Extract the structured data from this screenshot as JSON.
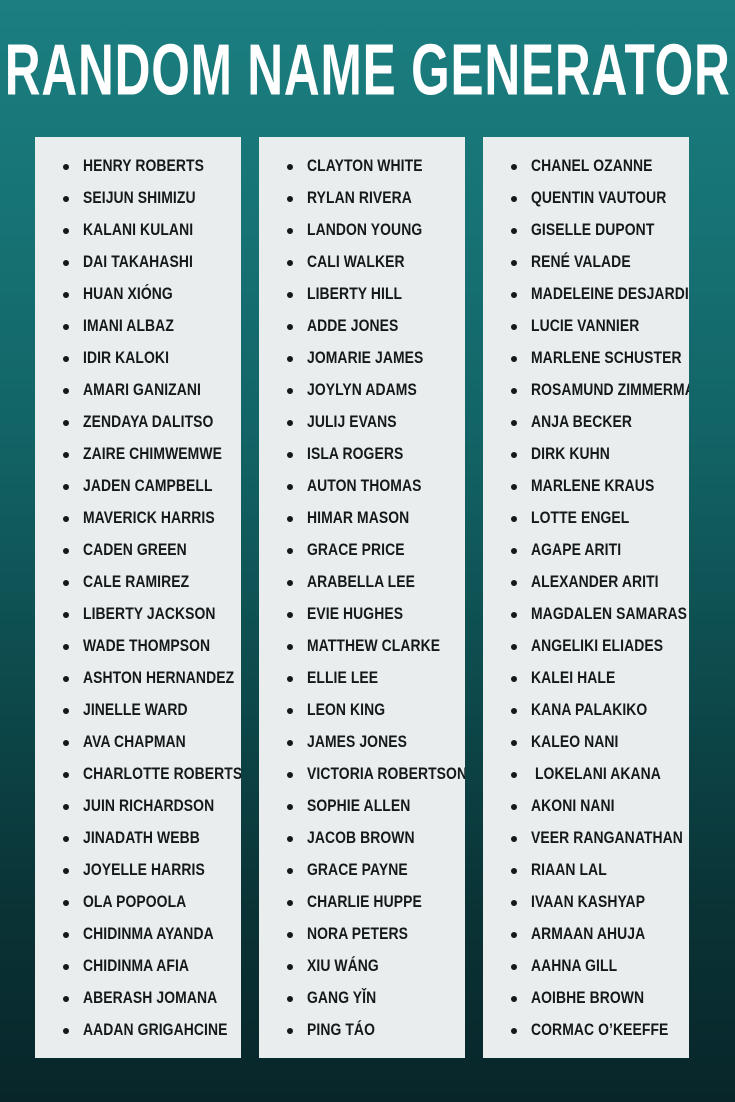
{
  "header": {
    "title": "RANDOM NAME GENERATOR"
  },
  "theme": {
    "background_top": "#1b7e80",
    "background_bottom": "#08262a",
    "card_background": "#e9edee",
    "title_color": "#ffffff",
    "text_color": "#14191a",
    "bullet_color": "#14191a"
  },
  "columns": [
    {
      "id": "column-1",
      "names": [
        "HENRY ROBERTS",
        "SEIJUN SHIMIZU",
        "KALANI KULANI",
        "DAI TAKAHASHI",
        "HUAN XIÓNG",
        "IMANI ALBAZ",
        "IDIR KALOKI",
        "AMARI GANIZANI",
        "ZENDAYA DALITSO",
        "ZAIRE CHIMWEMWE",
        "JADEN CAMPBELL",
        "MAVERICK HARRIS",
        "CADEN GREEN",
        "CALE RAMIREZ",
        "LIBERTY JACKSON",
        "WADE THOMPSON",
        "ASHTON HERNANDEZ",
        "JINELLE WARD",
        "AVA CHAPMAN",
        "CHARLOTTE ROBERTSON",
        "JUIN RICHARDSON",
        "JINADATH WEBB",
        "JOYELLE HARRIS",
        "OLA POPOOLA",
        "CHIDINMA AYANDA",
        "CHIDINMA AFIA",
        "ABERASH JOMANA",
        "AADAN GRIGAHCINE"
      ]
    },
    {
      "id": "column-2",
      "names": [
        "CLAYTON WHITE",
        "RYLAN RIVERA",
        "LANDON YOUNG",
        "CALI WALKER",
        "LIBERTY HILL",
        "ADDE JONES",
        "JOMARIE JAMES",
        "JOYLYN ADAMS",
        "JULIJ EVANS",
        "ISLA ROGERS",
        "AUTON THOMAS",
        "HIMAR MASON",
        "GRACE PRICE",
        "ARABELLA LEE",
        "EVIE HUGHES",
        "MATTHEW CLARKE",
        "ELLIE LEE",
        "LEON KING",
        "JAMES JONES",
        "VICTORIA ROBERTSON",
        "SOPHIE ALLEN",
        "JACOB BROWN",
        "GRACE PAYNE",
        "CHARLIE HUPPE",
        "NORA PETERS",
        "XIU WÁNG",
        "GANG YǏN",
        "PING TÁO"
      ]
    },
    {
      "id": "column-3",
      "names": [
        "CHANEL OZANNE",
        "QUENTIN VAUTOUR",
        "GISELLE DUPONT",
        "RENÉ VALADE",
        "MADELEINE DESJARDINS",
        "LUCIE VANNIER",
        "MARLENE SCHUSTER",
        "ROSAMUND ZIMMERMANN",
        "ANJA BECKER",
        "DIRK KUHN",
        "MARLENE KRAUS",
        "LOTTE ENGEL",
        "AGAPE ARITI",
        "ALEXANDER ARITI",
        "MAGDALEN SAMARAS",
        "ANGELIKI ELIADES",
        "KALEI HALE",
        "KANA PALAKIKO",
        "KALEO NANI",
        " LOKELANI AKANA",
        "AKONI NANI",
        "VEER RANGANATHAN",
        "RIAAN LAL",
        "IVAAN KASHYAP",
        "ARMAAN AHUJA",
        "AAHNA GILL",
        "AOIBHE BROWN",
        "CORMAC O’KEEFFE"
      ]
    }
  ]
}
